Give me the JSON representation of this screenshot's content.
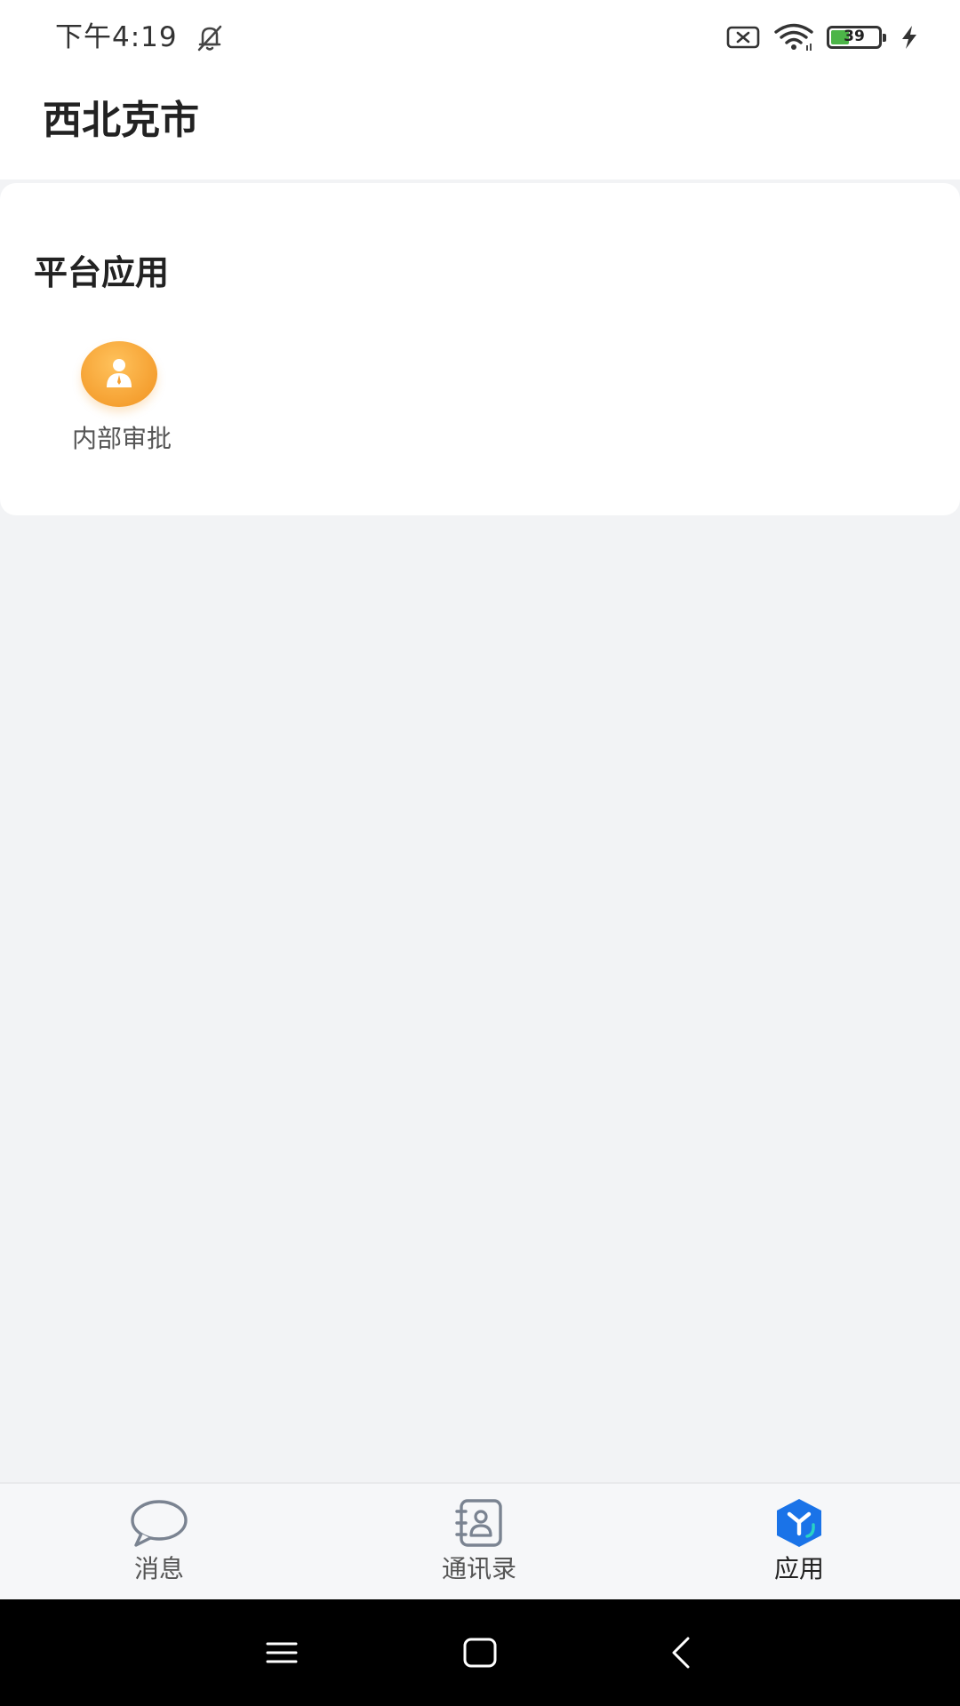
{
  "status_bar": {
    "time": "下午4:19",
    "battery_level": "39",
    "battery_fraction": 0.39,
    "icons": [
      "bell-off-icon",
      "no-sim-icon",
      "wifi-icon",
      "battery-icon",
      "charging-icon"
    ]
  },
  "header": {
    "title": "西北克市"
  },
  "platform_apps": {
    "section_title": "平台应用",
    "items": [
      {
        "label": "内部审批",
        "icon": "approval-person-icon",
        "icon_color": "#f5a031"
      }
    ]
  },
  "tab_bar": {
    "tabs": [
      {
        "label": "消息",
        "icon": "chat-bubble-icon",
        "active": false
      },
      {
        "label": "通讯录",
        "icon": "contacts-book-icon",
        "active": false
      },
      {
        "label": "应用",
        "icon": "apps-cube-icon",
        "active": true
      }
    ],
    "active_color": "#1a73e8"
  },
  "nav_bar": {
    "buttons": [
      "menu-icon",
      "home-icon",
      "back-icon"
    ]
  }
}
